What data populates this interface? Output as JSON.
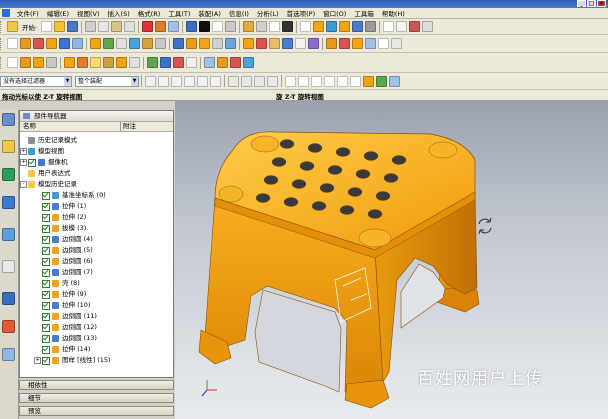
{
  "menu": {
    "items": [
      "文件(F)",
      "编辑(E)",
      "视图(V)",
      "插入(S)",
      "格式(R)",
      "工具(T)",
      "装配(A)",
      "信息(I)",
      "分析(L)",
      "首选项(P)",
      "窗口(O)",
      "工具箱",
      "帮助(H)"
    ]
  },
  "toolbar": {
    "start_label": "开始·",
    "filter_label": "没有选择过滤器",
    "assembly_scope": "整个装配"
  },
  "tabs": {
    "left_title": "拖动光标以使 Z-T 旋转视图",
    "right_title": "旋 Z-T 旋转视图"
  },
  "navigator": {
    "title": "部件导航器",
    "columns": {
      "name": "名称",
      "attached": "附注"
    },
    "items": [
      {
        "label": "历史记录模式",
        "checked": false,
        "expand": ""
      },
      {
        "label": "模型视图",
        "checked": false,
        "expand": "+"
      },
      {
        "label": "摄像机",
        "checked": true,
        "expand": "+"
      },
      {
        "label": "用户表达式",
        "checked": false,
        "expand": ""
      },
      {
        "label": "模型历史记录",
        "checked": false,
        "expand": "-"
      },
      {
        "label": "基准坐标系 (0)",
        "checked": true,
        "expand": ""
      },
      {
        "label": "拉伸 (1)",
        "checked": true,
        "expand": ""
      },
      {
        "label": "拉伸 (2)",
        "checked": true,
        "expand": ""
      },
      {
        "label": "拔模 (3)",
        "checked": true,
        "expand": ""
      },
      {
        "label": "边倒圆 (4)",
        "checked": true,
        "expand": ""
      },
      {
        "label": "边倒圆 (5)",
        "checked": true,
        "expand": ""
      },
      {
        "label": "边倒圆 (6)",
        "checked": true,
        "expand": ""
      },
      {
        "label": "边倒圆 (7)",
        "checked": true,
        "expand": ""
      },
      {
        "label": "壳 (8)",
        "checked": true,
        "expand": ""
      },
      {
        "label": "拉伸 (9)",
        "checked": true,
        "expand": ""
      },
      {
        "label": "拉伸 (10)",
        "checked": true,
        "expand": ""
      },
      {
        "label": "边倒圆 (11)",
        "checked": true,
        "expand": ""
      },
      {
        "label": "边倒圆 (12)",
        "checked": true,
        "expand": ""
      },
      {
        "label": "边倒圆 (13)",
        "checked": true,
        "expand": ""
      },
      {
        "label": "拉伸 (14)",
        "checked": true,
        "expand": ""
      },
      {
        "label": "图样 [线性] (15)",
        "checked": true,
        "expand": "+"
      }
    ]
  },
  "panels": {
    "dependencies": "相依性",
    "details": "细节",
    "preview": "预览"
  },
  "watermark": "百姓网用户上传",
  "colors": {
    "stool": "#f2a413",
    "stool_dark": "#c57a05",
    "titlebar": "#2a5cb8"
  }
}
